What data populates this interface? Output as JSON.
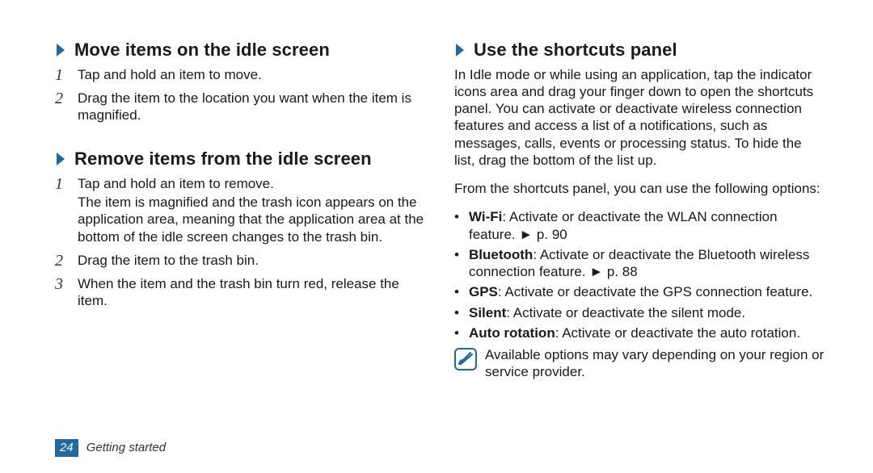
{
  "left": {
    "section1": {
      "heading": "Move items on the idle screen",
      "steps": [
        {
          "num": "1",
          "lines": [
            "Tap and hold an item to move."
          ]
        },
        {
          "num": "2",
          "lines": [
            "Drag the item to the location you want when the item is magnified."
          ]
        }
      ]
    },
    "section2": {
      "heading": "Remove items from the idle screen",
      "steps": [
        {
          "num": "1",
          "lines": [
            "Tap and hold an item to remove.",
            "The item is magnified and the trash icon appears on the application area, meaning that the application area at the bottom of the idle screen changes to the trash bin."
          ]
        },
        {
          "num": "2",
          "lines": [
            "Drag the item to the trash bin."
          ]
        },
        {
          "num": "3",
          "lines": [
            "When the item and the trash bin turn red, release the item."
          ]
        }
      ]
    }
  },
  "right": {
    "section1": {
      "heading": "Use the shortcuts panel",
      "para1": "In Idle mode or while using an application, tap the indicator icons area and drag your finger down to open the shortcuts panel. You can activate or deactivate wireless connection features and access a list of a notifications, such as messages, calls, events or processing status. To hide the list, drag the bottom of the list up.",
      "para2": "From the shortcuts panel, you can use the following options:",
      "bullets": [
        {
          "bold": "Wi-Fi",
          "rest": ": Activate or deactivate the WLAN connection feature. ► p. 90"
        },
        {
          "bold": "Bluetooth",
          "rest": ": Activate or deactivate the Bluetooth wireless connection feature. ► p. 88"
        },
        {
          "bold": "GPS",
          "rest": ": Activate or deactivate the GPS connection feature."
        },
        {
          "bold": "Silent",
          "rest": ": Activate or deactivate the silent mode."
        },
        {
          "bold": "Auto rotation",
          "rest": ": Activate or deactivate the auto rotation."
        }
      ],
      "note": "Available options may vary depending on your region or service provider."
    }
  },
  "footer": {
    "page_number": "24",
    "section_label": "Getting started"
  }
}
